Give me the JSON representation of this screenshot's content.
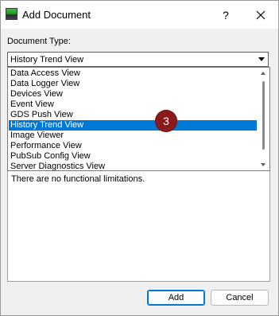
{
  "window": {
    "title": "Add Document",
    "help_label": "?"
  },
  "form": {
    "document_type_label": "Document Type:",
    "selected_value": "History Trend View"
  },
  "dropdown": {
    "items": [
      {
        "label": "Data Access View"
      },
      {
        "label": "Data Logger View"
      },
      {
        "label": "Devices View"
      },
      {
        "label": "Event View"
      },
      {
        "label": "GDS Push View"
      },
      {
        "label": "History Trend View",
        "selected": true
      },
      {
        "label": "Image Viewer"
      },
      {
        "label": "Performance View"
      },
      {
        "label": "PubSub Config View"
      },
      {
        "label": "Server Diagnostics View"
      }
    ]
  },
  "description": {
    "text": "There are no functional limitations."
  },
  "badge": {
    "number": "3",
    "color": "#8b1a1a"
  },
  "buttons": {
    "add_label": "Add",
    "cancel_label": "Cancel"
  },
  "colors": {
    "accent": "#0078d7",
    "dialog_bg": "#f0f0f0"
  },
  "icons": {
    "app": "app-document-icon",
    "close": "close-icon",
    "dropdown": "chevron-down-icon",
    "scroll_up": "scroll-up-arrow-icon",
    "scroll_down": "scroll-down-arrow-icon"
  }
}
